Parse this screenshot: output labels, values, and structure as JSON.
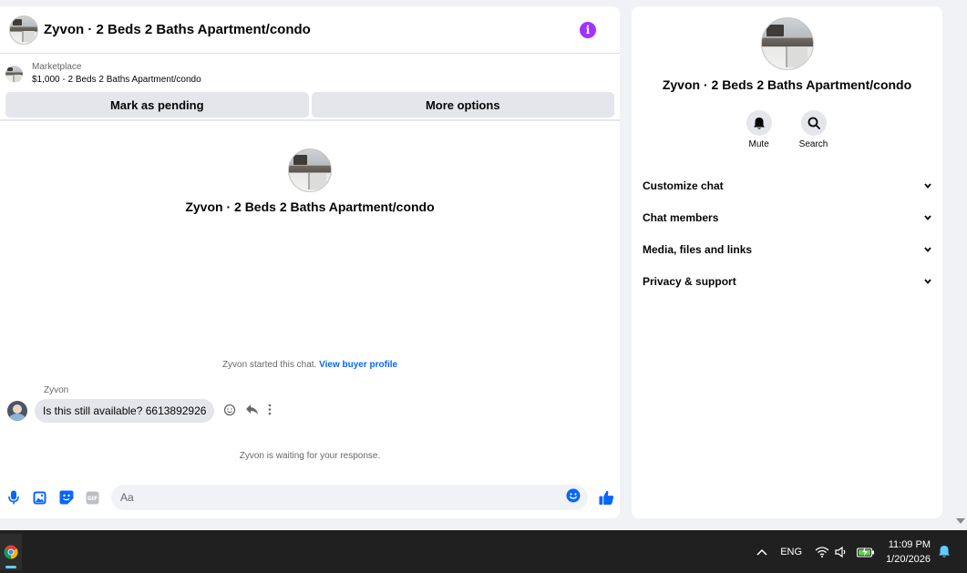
{
  "chat": {
    "header_title": "Zyvon · 2 Beds 2 Baths Apartment/condo",
    "info_icon": "i",
    "marketplace_label": "Marketplace",
    "listing_line": "$1,000 - 2 Beds 2 Baths Apartment/condo",
    "mark_pending_label": "Mark as pending",
    "more_options_label": "More options",
    "intro_title": "Zyvon · 2 Beds 2 Baths Apartment/condo",
    "started_text": "Zyvon started this chat.",
    "view_buyer_profile": "View buyer profile",
    "sender_name": "Zyvon",
    "message_text": "Is this still available? 6613892926",
    "waiting_text": "Zyvon is waiting for your response.",
    "composer_placeholder": "Aa"
  },
  "details": {
    "title": "Zyvon · 2 Beds 2 Baths Apartment/condo",
    "mute_label": "Mute",
    "search_label": "Search",
    "sections": [
      {
        "label": "Customize chat"
      },
      {
        "label": "Chat members"
      },
      {
        "label": "Media, files and links"
      },
      {
        "label": "Privacy & support"
      }
    ]
  },
  "taskbar": {
    "language": "ENG",
    "time": "11:09 PM",
    "date": "1/20/2026"
  },
  "colors": {
    "accent_blue": "#0866ff",
    "info_purple": "#a033ff",
    "taskbar_bg": "#202020"
  },
  "icons": [
    "info-icon",
    "microphone-icon",
    "image-icon",
    "sticker-icon",
    "gif-icon",
    "emoji-icon",
    "thumbs-up-icon",
    "bell-icon",
    "search-icon",
    "chevron-down-icon",
    "react-icon",
    "reply-icon",
    "more-icon",
    "chrome-icon",
    "chevron-up-icon",
    "wifi-icon",
    "speaker-icon",
    "battery-icon",
    "notification-bell-icon"
  ]
}
